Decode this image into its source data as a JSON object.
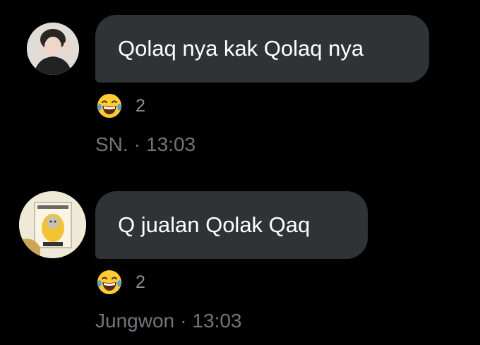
{
  "messages": [
    {
      "avatar": "person-avatar",
      "text": "Qolaq nya kak Qolaq nya",
      "reaction": {
        "emoji": "face-with-tears-of-joy",
        "count": "2"
      },
      "sender": "SN.",
      "separator": "·",
      "time": "13:03"
    },
    {
      "avatar": "yellow-cartoon-avatar",
      "text": "Q jualan Qolak Qaq",
      "reaction": {
        "emoji": "face-with-tears-of-joy",
        "count": "2"
      },
      "sender": "Jungwon",
      "separator": "·",
      "time": "13:03"
    }
  ],
  "colors": {
    "background": "#000000",
    "bubble": "#2f3336",
    "meta_text": "#71767b",
    "emoji_yellow": "#ffcc33"
  }
}
